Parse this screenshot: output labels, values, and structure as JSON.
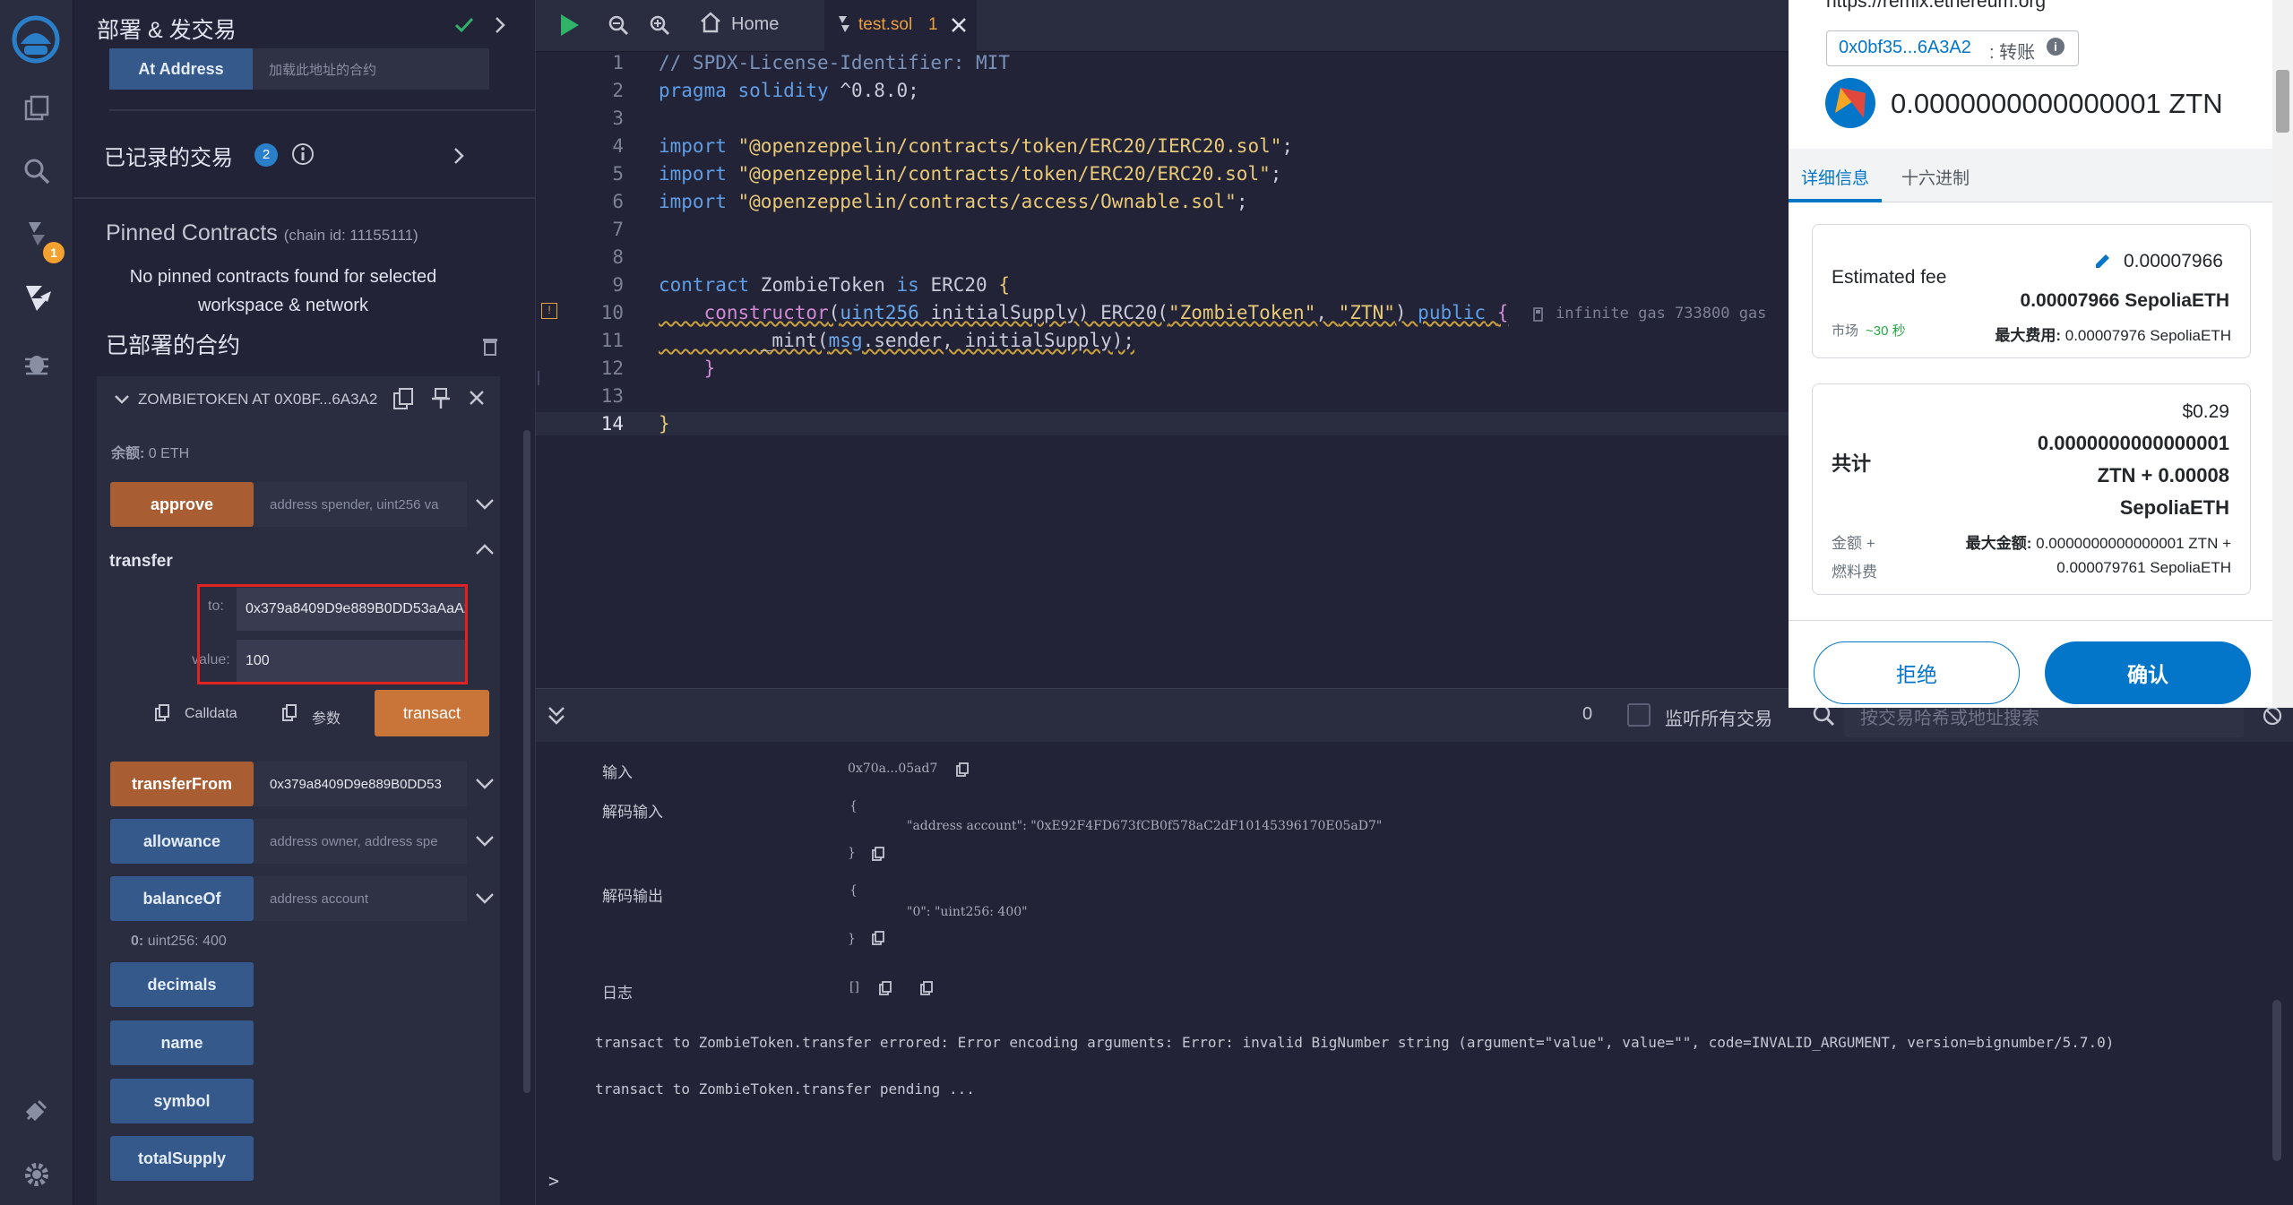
{
  "sidebar": {
    "title": "部署 & 发交易",
    "at_address_button": "At Address",
    "at_address_placeholder": "加载此地址的合约",
    "recorded_tx_label": "已记录的交易",
    "recorded_tx_count": "2",
    "pinned_title": "Pinned Contracts",
    "pinned_chain": "(chain id: 11155111)",
    "pinned_empty_line1": "No pinned contracts found for selected",
    "pinned_empty_line2": "workspace & network",
    "deployed_title": "已部署的合约",
    "contract_name": "ZOMBIETOKEN AT 0X0BF...6A3A2",
    "balance_label": "余额:",
    "balance_value": "0 ETH",
    "approve_label": "approve",
    "approve_placeholder": "address spender, uint256 va",
    "transfer_label": "transfer",
    "to_label": "to:",
    "to_value": "0x379a8409D9e889B0DD53aAaA2",
    "value_label": "value:",
    "value_value": "100",
    "calldata_label": "Calldata",
    "params_label": "参数",
    "transact_label": "transact",
    "transferfrom_label": "transferFrom",
    "transferfrom_value": "0x379a8409D9e889B0DD53",
    "allowance_label": "allowance",
    "allowance_placeholder": "address owner, address spe",
    "balanceof_label": "balanceOf",
    "balanceof_placeholder": "address account",
    "balanceof_result_key": "0:",
    "balanceof_result_value": "uint256: 400",
    "decimals_label": "decimals",
    "name_label": "name",
    "symbol_label": "symbol",
    "totalsupply_label": "totalSupply",
    "plugin_badge": "1"
  },
  "editor": {
    "home_tab": "Home",
    "file_tab": "test.sol",
    "file_tab_count": "1",
    "gas_hint": "infinite gas 733800 gas",
    "line_numbers": [
      "1",
      "2",
      "3",
      "4",
      "5",
      "6",
      "7",
      "8",
      "9",
      "10",
      "11",
      "12",
      "13",
      "14"
    ]
  },
  "terminal": {
    "counter": "0",
    "listen_label": "监听所有交易",
    "search_placeholder": "按交易哈希或地址搜索",
    "input_label": "输入",
    "input_value": "0x70a...05ad7",
    "decoded_input_label": "解码输入",
    "decoded_input_open": "{",
    "decoded_input_value": "\"address account\": \"0xE92F4FD673fCB0f578aC2dF10145396170E05aD7\"",
    "decoded_input_close": "}",
    "decoded_output_label": "解码输出",
    "decoded_output_open": "{",
    "decoded_output_value": "\"0\": \"uint256: 400\"",
    "decoded_output_close": "}",
    "logs_label": "日志",
    "logs_value": "[]",
    "error_line": "transact to ZombieToken.transfer errored: Error encoding arguments: Error: invalid BigNumber string (argument=\"value\", value=\"\", code=INVALID_ARGUMENT, version=bignumber/5.7.0)",
    "pending_line": "transact to ZombieToken.transfer pending ...",
    "prompt": ">"
  },
  "metamask": {
    "origin": "https://remix.ethereum.org",
    "address_chip": "0x0bf35...6A3A2",
    "address_action": ": 转账",
    "amount": "0.0000000000000001 ZTN",
    "tab_details": "详细信息",
    "tab_hex": "十六进制",
    "estimated_fee_label": "Estimated fee",
    "fee_small": "0.00007966",
    "fee_big": "0.00007966 SepoliaETH",
    "market_label": "市场",
    "market_time": "~30 秒",
    "max_fee_label": "最大费用:",
    "max_fee_value": "0.00007976 SepoliaETH",
    "total_usd": "$0.29",
    "total_label": "共计",
    "total_line1": "0.0000000000000001",
    "total_line2": "ZTN + 0.00008",
    "total_line3": "SepoliaETH",
    "amount_gas_label1": "金额 +",
    "amount_gas_label2": "燃料费",
    "max_amount_label": "最大金额:",
    "max_amount_value1": "0.0000000000000001 ZTN +",
    "max_amount_value2": "0.000079761 SepoliaETH",
    "reject_label": "拒绝",
    "confirm_label": "确认"
  },
  "colors": {
    "accent_orange": "#c97539",
    "accent_blue": "#36598c",
    "metamask_blue": "#0376c9",
    "highlight_red": "#e22222"
  }
}
